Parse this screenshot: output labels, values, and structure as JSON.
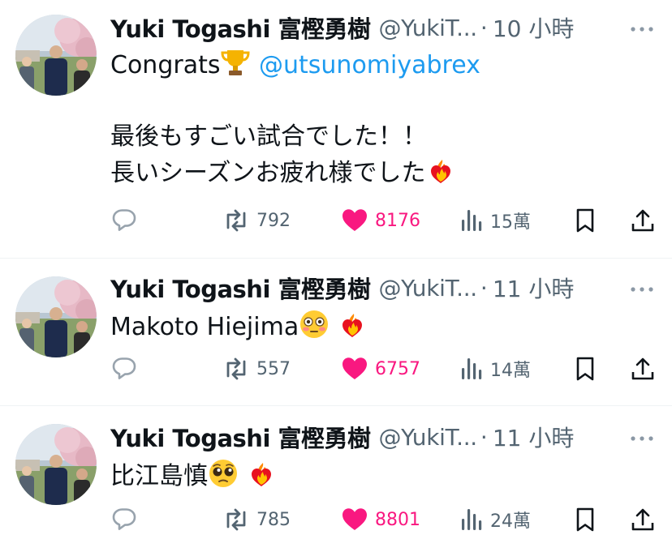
{
  "tweets": [
    {
      "author_name": "Yuki Togashi 富樫勇樹",
      "handle": "@YukiT...",
      "time": "10 小時",
      "text_before_trophy": "Congrats",
      "mention": "@utsunomiyabrex",
      "line2": "最後もすごい試合でした！！",
      "line3": "長いシーズンお疲れ様でした",
      "retweets": "792",
      "likes": "8176",
      "views": "15萬"
    },
    {
      "author_name": "Yuki Togashi 富樫勇樹",
      "handle": "@YukiT...",
      "time": "11 小時",
      "text": "Makoto Hiejima",
      "retweets": "557",
      "likes": "6757",
      "views": "14萬"
    },
    {
      "author_name": "Yuki Togashi 富樫勇樹",
      "handle": "@YukiT...",
      "time": "11 小時",
      "text": "比江島慎",
      "retweets": "785",
      "likes": "8801",
      "views": "24萬"
    }
  ],
  "icons": [
    "reply-icon",
    "retweet-icon",
    "heart-icon",
    "views-icon",
    "bookmark-icon",
    "share-icon",
    "more-icon",
    "trophy-icon",
    "flushed-face-emoji",
    "pleading-face-emoji",
    "heart-on-fire-emoji"
  ],
  "colors": {
    "like": "#f91880",
    "mention": "#1d9bf0",
    "muted": "#536471",
    "divider": "#eff3f4"
  }
}
